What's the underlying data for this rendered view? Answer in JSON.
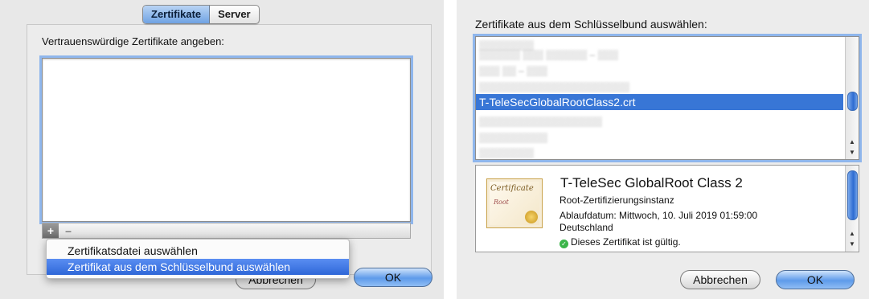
{
  "left": {
    "tabs": [
      {
        "label": "Zertifikate",
        "selected": true
      },
      {
        "label": "Server",
        "selected": false
      }
    ],
    "instruction": "Vertrauenswürdige Zertifikate angeben:",
    "plus_label": "+",
    "minus_label": "–",
    "menu": {
      "items": [
        {
          "label": "Zertifikatsdatei auswählen",
          "highlighted": false
        },
        {
          "label": "Zertifikat aus dem Schlüsselbund auswählen",
          "highlighted": true
        }
      ]
    },
    "buttons": {
      "cancel": "Abbrechen",
      "ok": "OK"
    }
  },
  "right": {
    "instruction": "Zertifikate aus dem Schlüsselbund auswählen:",
    "list": {
      "selected_item": "T-TeleSecGlobalRootClass2.crt"
    },
    "detail": {
      "image_text_1": "Certificate",
      "image_text_2": "Root",
      "title": "T-TeleSec GlobalRoot Class 2",
      "type": "Root-Zertifizierungsinstanz",
      "expiry": "Ablaufdatum: Mittwoch, 10. Juli 2019 01:59:00",
      "country": "Deutschland",
      "status": "Dieses Zertifikat ist gültig.",
      "status_color": "#3bb54a"
    },
    "buttons": {
      "cancel": "Abbrechen",
      "ok": "OK"
    }
  },
  "colors": {
    "accent": "#3876d6",
    "focus_ring": "#8fb6ec"
  }
}
